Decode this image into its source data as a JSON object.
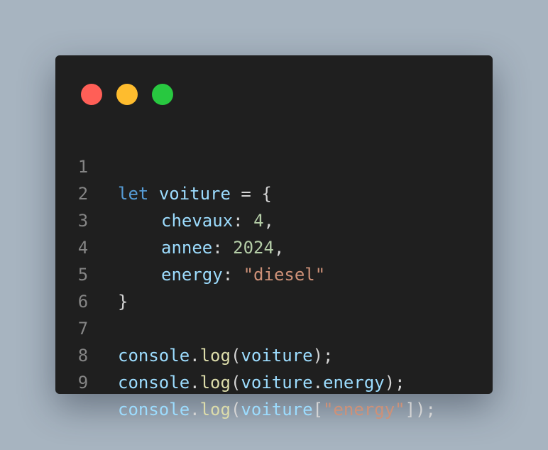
{
  "window": {
    "controls": [
      {
        "name": "close",
        "color": "#ff5f57"
      },
      {
        "name": "minimize",
        "color": "#febc2e"
      },
      {
        "name": "maximize",
        "color": "#28c840"
      }
    ]
  },
  "code": {
    "lines": [
      {
        "number": "1",
        "tokens": {
          "kw": "let",
          "var": "voiture",
          "op": "=",
          "brace": "{"
        }
      },
      {
        "number": "2",
        "tokens": {
          "key": "chevaux",
          "colon": ":",
          "value": "4",
          "comma": ","
        }
      },
      {
        "number": "3",
        "tokens": {
          "key": "annee",
          "colon": ":",
          "value": "2024",
          "comma": ","
        }
      },
      {
        "number": "4",
        "tokens": {
          "key": "energy",
          "colon": ":",
          "value": "\"diesel\""
        }
      },
      {
        "number": "5",
        "tokens": {
          "brace": "}"
        }
      },
      {
        "number": "6",
        "tokens": {}
      },
      {
        "number": "7",
        "tokens": {
          "obj": "console",
          "dot": ".",
          "fn": "log",
          "open": "(",
          "arg": "voiture",
          "close": ");"
        }
      },
      {
        "number": "8",
        "tokens": {
          "obj": "console",
          "dot": ".",
          "fn": "log",
          "open": "(",
          "arg": "voiture",
          "dot2": ".",
          "prop": "energy",
          "close": ");"
        }
      },
      {
        "number": "9",
        "tokens": {
          "obj": "console",
          "dot": ".",
          "fn": "log",
          "open": "(",
          "arg": "voiture",
          "bopen": "[",
          "str": "\"energy\"",
          "close": "]);"
        }
      }
    ]
  }
}
